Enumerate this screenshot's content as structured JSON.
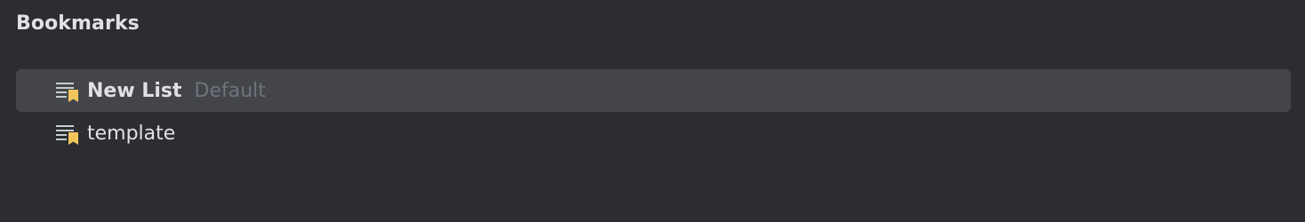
{
  "panel": {
    "title": "Bookmarks"
  },
  "lists": [
    {
      "label": "New List",
      "hint": "Default",
      "icon": "bookmark-list-icon",
      "selected": true
    },
    {
      "label": "template",
      "hint": "",
      "icon": "bookmark-list-icon",
      "selected": false
    }
  ],
  "colors": {
    "background": "#2b2d30",
    "selection": "#43454a",
    "text": "#dfe1e5",
    "hint": "#6f737a",
    "bookmark_accent": "#f2c55c"
  }
}
